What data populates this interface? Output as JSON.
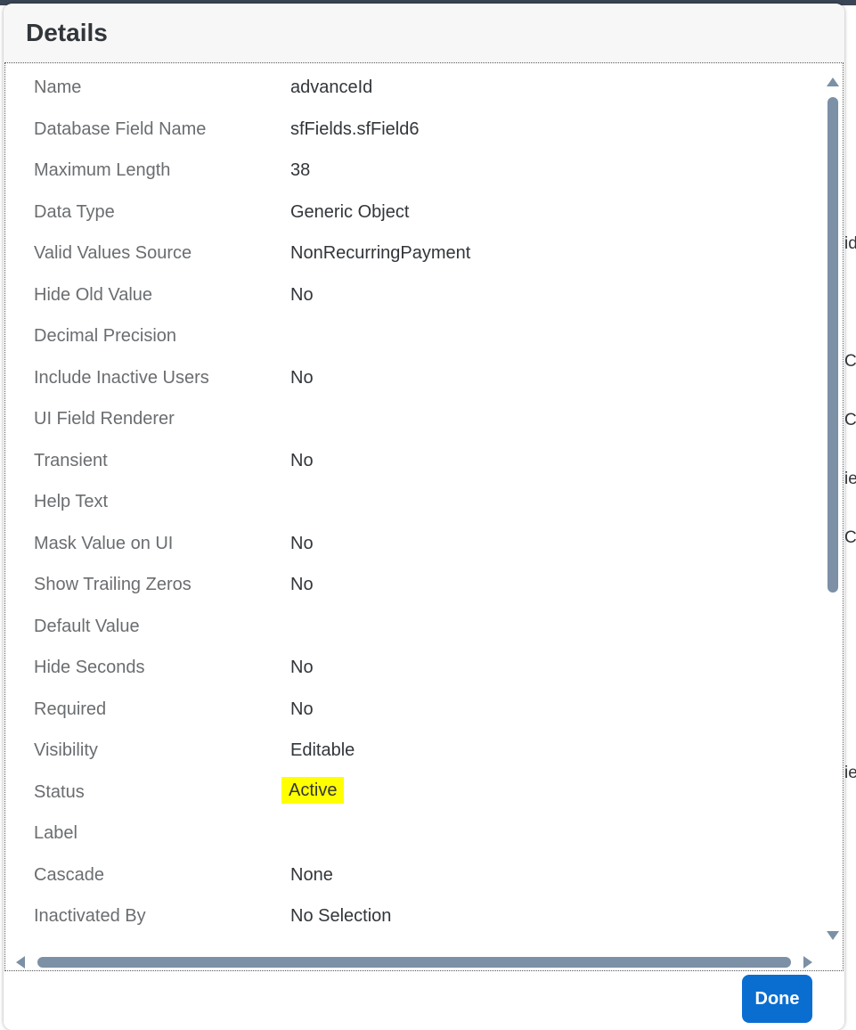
{
  "dialog": {
    "title": "Details",
    "done_label": "Done"
  },
  "fields": [
    {
      "label": "Name",
      "value": "advanceId"
    },
    {
      "label": "Database Field Name",
      "value": "sfFields.sfField6"
    },
    {
      "label": "Maximum Length",
      "value": "38"
    },
    {
      "label": "Data Type",
      "value": "Generic Object"
    },
    {
      "label": "Valid Values Source",
      "value": "NonRecurringPayment"
    },
    {
      "label": "Hide Old Value",
      "value": "No"
    },
    {
      "label": "Decimal Precision",
      "value": ""
    },
    {
      "label": "Include Inactive Users",
      "value": "No"
    },
    {
      "label": "UI Field Renderer",
      "value": ""
    },
    {
      "label": "Transient",
      "value": "No"
    },
    {
      "label": "Help Text",
      "value": ""
    },
    {
      "label": "Mask Value on UI",
      "value": "No"
    },
    {
      "label": "Show Trailing Zeros",
      "value": "No"
    },
    {
      "label": "Default Value",
      "value": ""
    },
    {
      "label": "Hide Seconds",
      "value": "No"
    },
    {
      "label": "Required",
      "value": "No"
    },
    {
      "label": "Visibility",
      "value": "Editable"
    },
    {
      "label": "Status",
      "value": "Active",
      "highlight": true
    },
    {
      "label": "Label",
      "value": ""
    },
    {
      "label": "Cascade",
      "value": "None"
    },
    {
      "label": "Inactivated By",
      "value": "No Selection"
    }
  ],
  "background_fragments": [
    "id",
    "C",
    "C",
    "ie",
    "C",
    "ie"
  ],
  "colors": {
    "primary_button": "#0a6ed1",
    "highlight": "#ffff00",
    "scrollbar": "#7c90a6"
  }
}
